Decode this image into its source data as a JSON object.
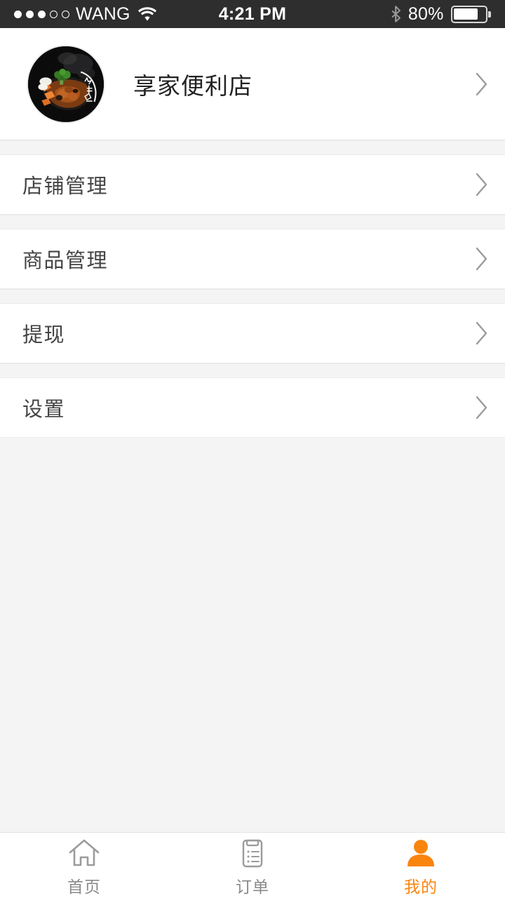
{
  "statusbar": {
    "signal_filled": 3,
    "signal_hollow": 2,
    "carrier": "WANG",
    "wifi_icon": "wifi-icon",
    "time": "4:21 PM",
    "bluetooth_icon": "bluetooth-icon",
    "battery_percent": "80%",
    "battery_level": 80,
    "background": "#2e2e2e",
    "foreground": "#ffffff"
  },
  "profile": {
    "avatar_icon": "shop-avatar-food-photo",
    "shop_name": "享家便利店",
    "chevron_icon": "chevron-right-icon"
  },
  "menu": {
    "groups": [
      {
        "items": [
          {
            "label": "店铺管理",
            "chevron_icon": "chevron-right-icon"
          }
        ]
      },
      {
        "items": [
          {
            "label": "商品管理",
            "chevron_icon": "chevron-right-icon"
          }
        ]
      },
      {
        "items": [
          {
            "label": "提现",
            "chevron_icon": "chevron-right-icon"
          }
        ]
      },
      {
        "items": [
          {
            "label": "设置",
            "chevron_icon": "chevron-right-icon"
          }
        ]
      }
    ]
  },
  "tabbar": {
    "active_color": "#f9850f",
    "inactive_color": "#8a8a8a",
    "tabs": [
      {
        "label": "首页",
        "icon": "home-icon",
        "active": false
      },
      {
        "label": "订单",
        "icon": "clipboard-list-icon",
        "active": false
      },
      {
        "label": "我的",
        "icon": "person-icon",
        "active": true
      }
    ]
  }
}
